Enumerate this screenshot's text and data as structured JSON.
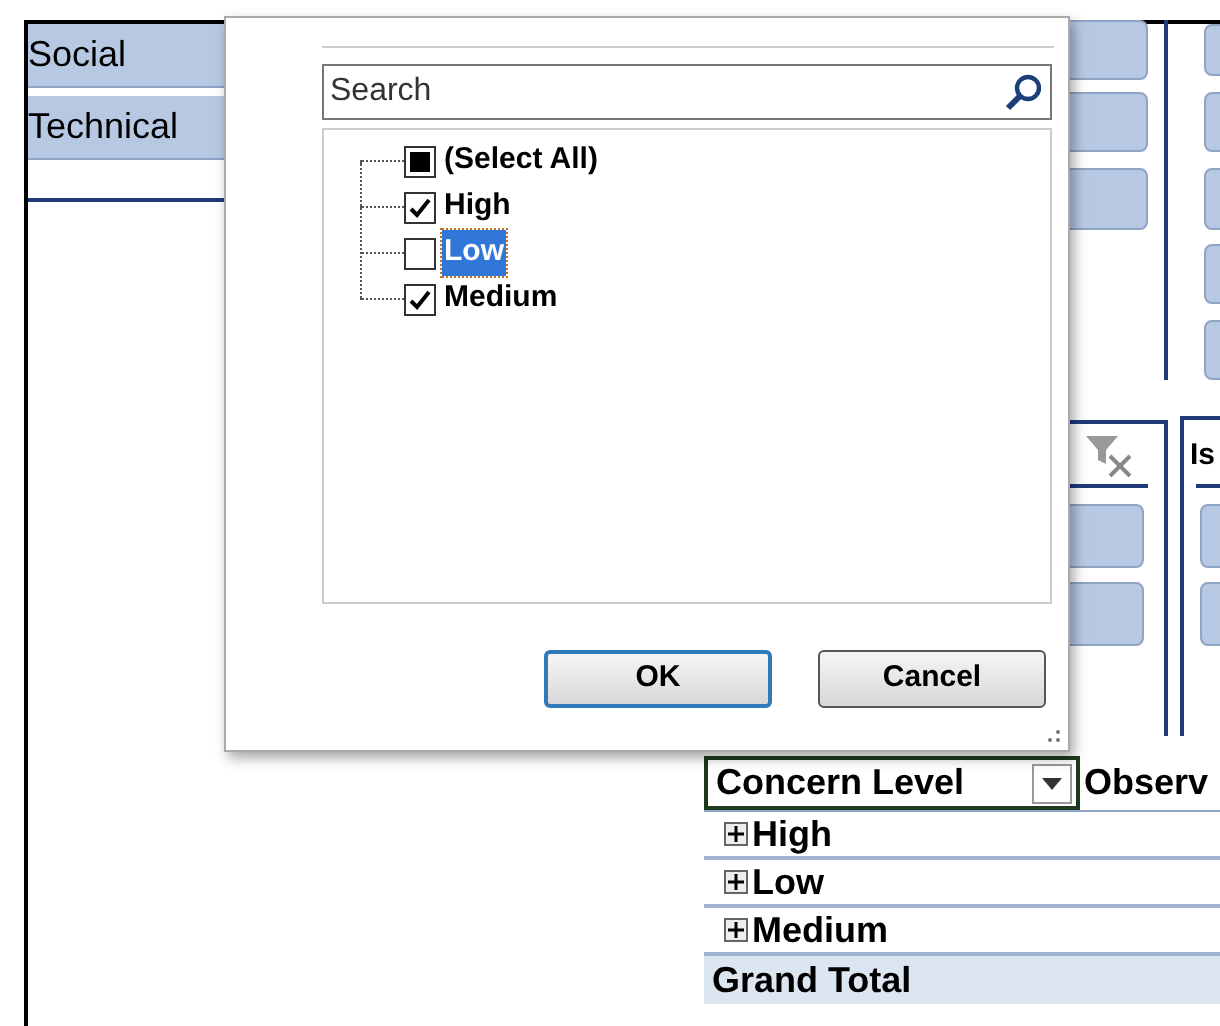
{
  "left_slicer": {
    "items": [
      {
        "label": "Social"
      },
      {
        "label": "Technical"
      }
    ]
  },
  "right_slicer": {
    "title": "Is"
  },
  "filter_dialog": {
    "search": {
      "placeholder": "Search"
    },
    "items": [
      {
        "label": "(Select All)",
        "indeterminate": true,
        "selected": false
      },
      {
        "label": "High",
        "checked": true,
        "selected": false
      },
      {
        "label": "Low",
        "checked": false,
        "selected": true
      },
      {
        "label": "Medium",
        "checked": true,
        "selected": false
      }
    ],
    "buttons": [
      {
        "label": "OK",
        "default": true
      },
      {
        "label": "Cancel",
        "default": false
      }
    ]
  },
  "pivot_table": {
    "columns": [
      "Concern Level",
      "Observ"
    ],
    "rows": [
      {
        "label": "High"
      },
      {
        "label": "Low"
      },
      {
        "label": "Medium"
      }
    ],
    "grand_total": "Grand Total"
  }
}
